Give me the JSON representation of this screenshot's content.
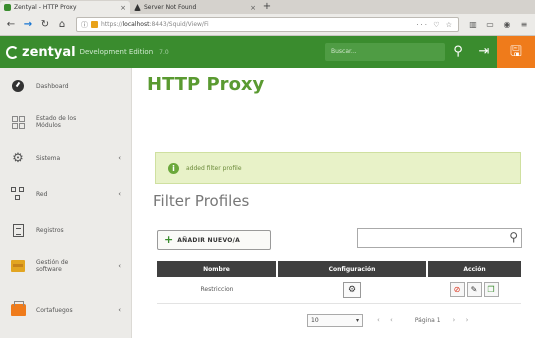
{
  "browser": {
    "tabs": [
      {
        "title": "Zentyal - HTTP Proxy",
        "favicon_color": "#3a8c2e",
        "active": true
      },
      {
        "title": "Server Not Found",
        "favicon_color": "#333333",
        "active": false
      }
    ],
    "close_glyph": "×",
    "new_tab_glyph": "+",
    "url_prefix": "https://",
    "url_host": "localhost",
    "url_path": ":8443/Squid/View/Fi",
    "url_actions": "··· ♡ ☆",
    "icons": [
      "back-icon",
      "forward-icon",
      "reload-icon",
      "home-icon",
      "library-icon",
      "sidebar-icon",
      "menu-icon"
    ]
  },
  "header": {
    "brand": "zentyal",
    "edition": "Development Edition",
    "edition_extra": "7.0",
    "search_placeholder": "Buscar...",
    "brand_color": "#3a8c2e",
    "save_color": "#ef7b1b"
  },
  "sidebar": {
    "items": [
      {
        "label": "Dashboard",
        "icon": "dashboard-icon",
        "has_submenu": false
      },
      {
        "label": "Estado de los Módulos",
        "icon": "modules-icon",
        "has_submenu": false
      },
      {
        "label": "Sistema",
        "icon": "gear-icon",
        "has_submenu": true
      },
      {
        "label": "Red",
        "icon": "network-icon",
        "has_submenu": true
      },
      {
        "label": "Registros",
        "icon": "logs-icon",
        "has_submenu": false
      },
      {
        "label": "Gestión de software",
        "icon": "package-icon",
        "has_submenu": true
      },
      {
        "label": "Cortafuegos",
        "icon": "firewall-icon",
        "has_submenu": true
      }
    ],
    "submenu_glyph": "‹"
  },
  "main": {
    "title": "HTTP Proxy",
    "notice": "added filter profile",
    "section_title": "Filter Profiles",
    "add_button": "AÑADIR NUEVO/A",
    "search_value": "",
    "table": {
      "headers": [
        "Nombre",
        "Configuración",
        "Acción"
      ],
      "rows": [
        {
          "name": "Restriccion"
        }
      ]
    },
    "pager": {
      "page_size": "10",
      "page_label": "Página 1"
    }
  }
}
